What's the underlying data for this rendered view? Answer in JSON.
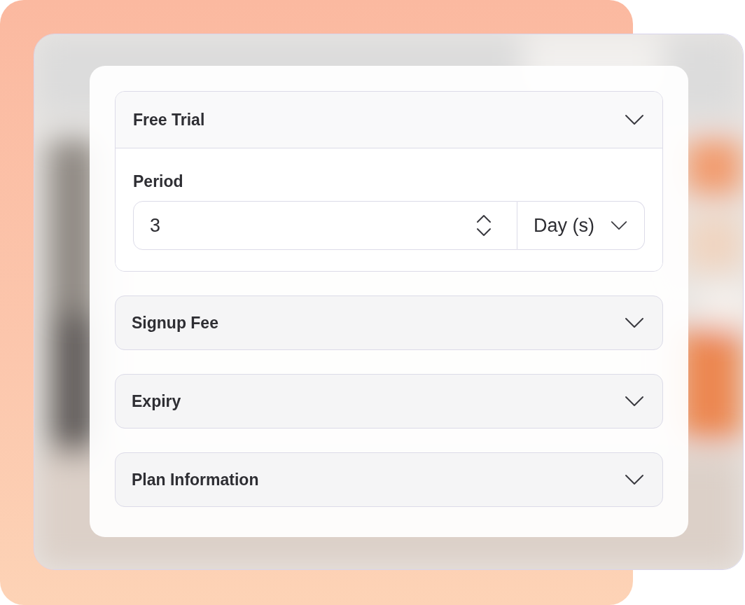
{
  "sections": [
    {
      "title": "Free Trial",
      "expanded": true,
      "field": {
        "label": "Period",
        "value": "3",
        "unit": "Day (s)"
      }
    },
    {
      "title": "Signup Fee",
      "expanded": false
    },
    {
      "title": "Expiry",
      "expanded": false
    },
    {
      "title": "Plan Information",
      "expanded": false
    }
  ]
}
